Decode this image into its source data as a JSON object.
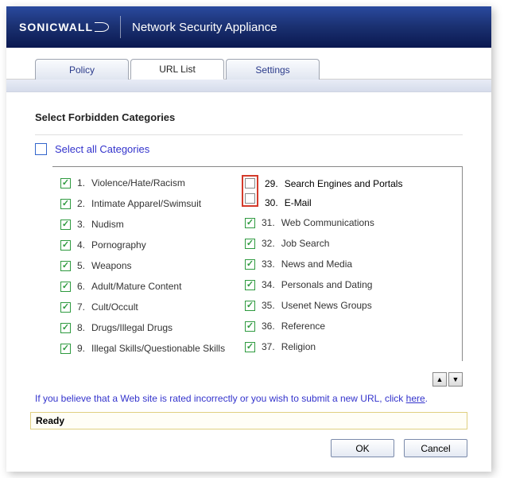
{
  "header": {
    "brand": "SONICWALL",
    "product": "Network Security Appliance"
  },
  "tabs": [
    {
      "label": "Policy",
      "active": false
    },
    {
      "label": "URL List",
      "active": true
    },
    {
      "label": "Settings",
      "active": false
    }
  ],
  "section_title": "Select Forbidden Categories",
  "select_all_label": "Select all Categories",
  "categories_left": [
    {
      "num": "1.",
      "label": "Violence/Hate/Racism",
      "checked": true
    },
    {
      "num": "2.",
      "label": "Intimate Apparel/Swimsuit",
      "checked": true
    },
    {
      "num": "3.",
      "label": "Nudism",
      "checked": true
    },
    {
      "num": "4.",
      "label": "Pornography",
      "checked": true
    },
    {
      "num": "5.",
      "label": "Weapons",
      "checked": true
    },
    {
      "num": "6.",
      "label": "Adult/Mature Content",
      "checked": true
    },
    {
      "num": "7.",
      "label": "Cult/Occult",
      "checked": true
    },
    {
      "num": "8.",
      "label": "Drugs/Illegal Drugs",
      "checked": true
    },
    {
      "num": "9.",
      "label": "Illegal Skills/Questionable Skills",
      "checked": true
    }
  ],
  "categories_right": [
    {
      "num": "29.",
      "label": "Search Engines and Portals",
      "checked": false,
      "highlighted": true
    },
    {
      "num": "30.",
      "label": "E-Mail",
      "checked": false,
      "highlighted": true
    },
    {
      "num": "31.",
      "label": "Web Communications",
      "checked": true
    },
    {
      "num": "32.",
      "label": "Job Search",
      "checked": true
    },
    {
      "num": "33.",
      "label": "News and Media",
      "checked": true
    },
    {
      "num": "34.",
      "label": "Personals and Dating",
      "checked": true
    },
    {
      "num": "35.",
      "label": "Usenet News Groups",
      "checked": true
    },
    {
      "num": "36.",
      "label": "Reference",
      "checked": true
    },
    {
      "num": "37.",
      "label": "Religion",
      "checked": true
    }
  ],
  "note_text": "If you believe that a Web site is rated incorrectly or you wish to submit a new URL, click ",
  "note_link": "here",
  "status": "Ready",
  "buttons": {
    "ok": "OK",
    "cancel": "Cancel"
  }
}
